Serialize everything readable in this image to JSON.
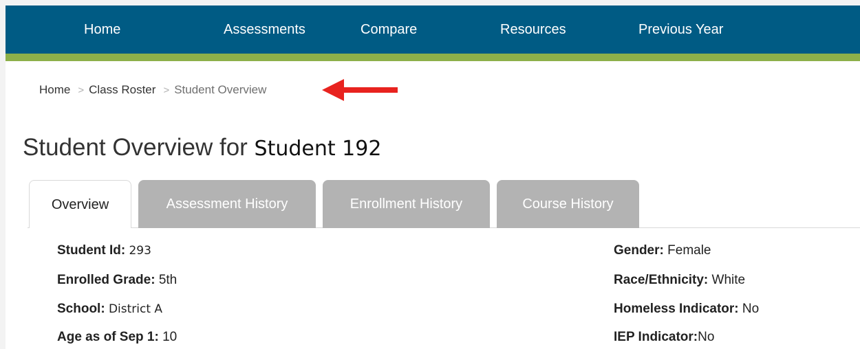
{
  "nav": {
    "items": [
      {
        "label": "Home"
      },
      {
        "label": "Assessments"
      },
      {
        "label": "Compare"
      },
      {
        "label": "Resources"
      },
      {
        "label": "Previous Year"
      }
    ],
    "colors": {
      "bar": "#005b84",
      "accent": "#8db04a",
      "text": "#ffffff"
    }
  },
  "breadcrumb": {
    "items": [
      "Home",
      "Class Roster",
      "Student Overview"
    ],
    "separator": ">",
    "annotation_arrow": {
      "color": "#e8231f",
      "direction": "left",
      "icon": "red-arrow-icon"
    }
  },
  "page": {
    "title_prefix": "Student Overview for",
    "student_name": "Student 192"
  },
  "tabs": [
    {
      "label": "Overview",
      "active": true
    },
    {
      "label": "Assessment History",
      "active": false
    },
    {
      "label": "Enrollment History",
      "active": false
    },
    {
      "label": "Course History",
      "active": false
    }
  ],
  "details": {
    "left": [
      {
        "label": "Student Id:",
        "value": "293"
      },
      {
        "label": "Enrolled Grade:",
        "value": "5th"
      },
      {
        "label": "School:",
        "value": "District A"
      },
      {
        "label": "Age as of Sep 1:",
        "value": "10"
      }
    ],
    "right": [
      {
        "label": "Gender:",
        "value": "Female"
      },
      {
        "label": "Race/Ethnicity:",
        "value": "White"
      },
      {
        "label": "Homeless Indicator:",
        "value": "No"
      },
      {
        "label": "IEP Indicator:",
        "value": "No"
      }
    ]
  }
}
